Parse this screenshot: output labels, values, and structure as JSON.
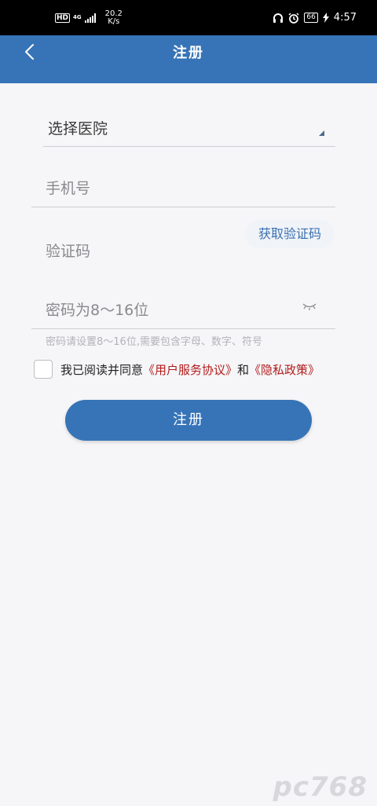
{
  "status_bar": {
    "hd": "HD",
    "network": "4G",
    "speed_value": "20.2",
    "speed_unit": "K/s",
    "battery": "66",
    "time": "4:57"
  },
  "header": {
    "title": "注册"
  },
  "form": {
    "hospital_label": "选择医院",
    "phone_placeholder": "手机号",
    "code_placeholder": "验证码",
    "get_code_label": "获取验证码",
    "password_placeholder": "密码为8～16位",
    "password_hint": "密码请设置8～16位,需要包含字母、数字、符号"
  },
  "agreement": {
    "prefix": "我已阅读并同意",
    "user_agreement": "《用户服务协议》",
    "conjunction": "和",
    "privacy_policy": "《隐私政策》"
  },
  "submit_label": "注册",
  "watermark": "pc768",
  "colors": {
    "primary": "#3774b7",
    "link_red": "#b21b1b",
    "background": "#f6f6f8"
  },
  "icons": [
    "back-arrow-icon",
    "dropdown-triangle-icon",
    "eye-closed-icon",
    "headphones-icon",
    "alarm-icon",
    "charging-icon",
    "signal-icon"
  ]
}
